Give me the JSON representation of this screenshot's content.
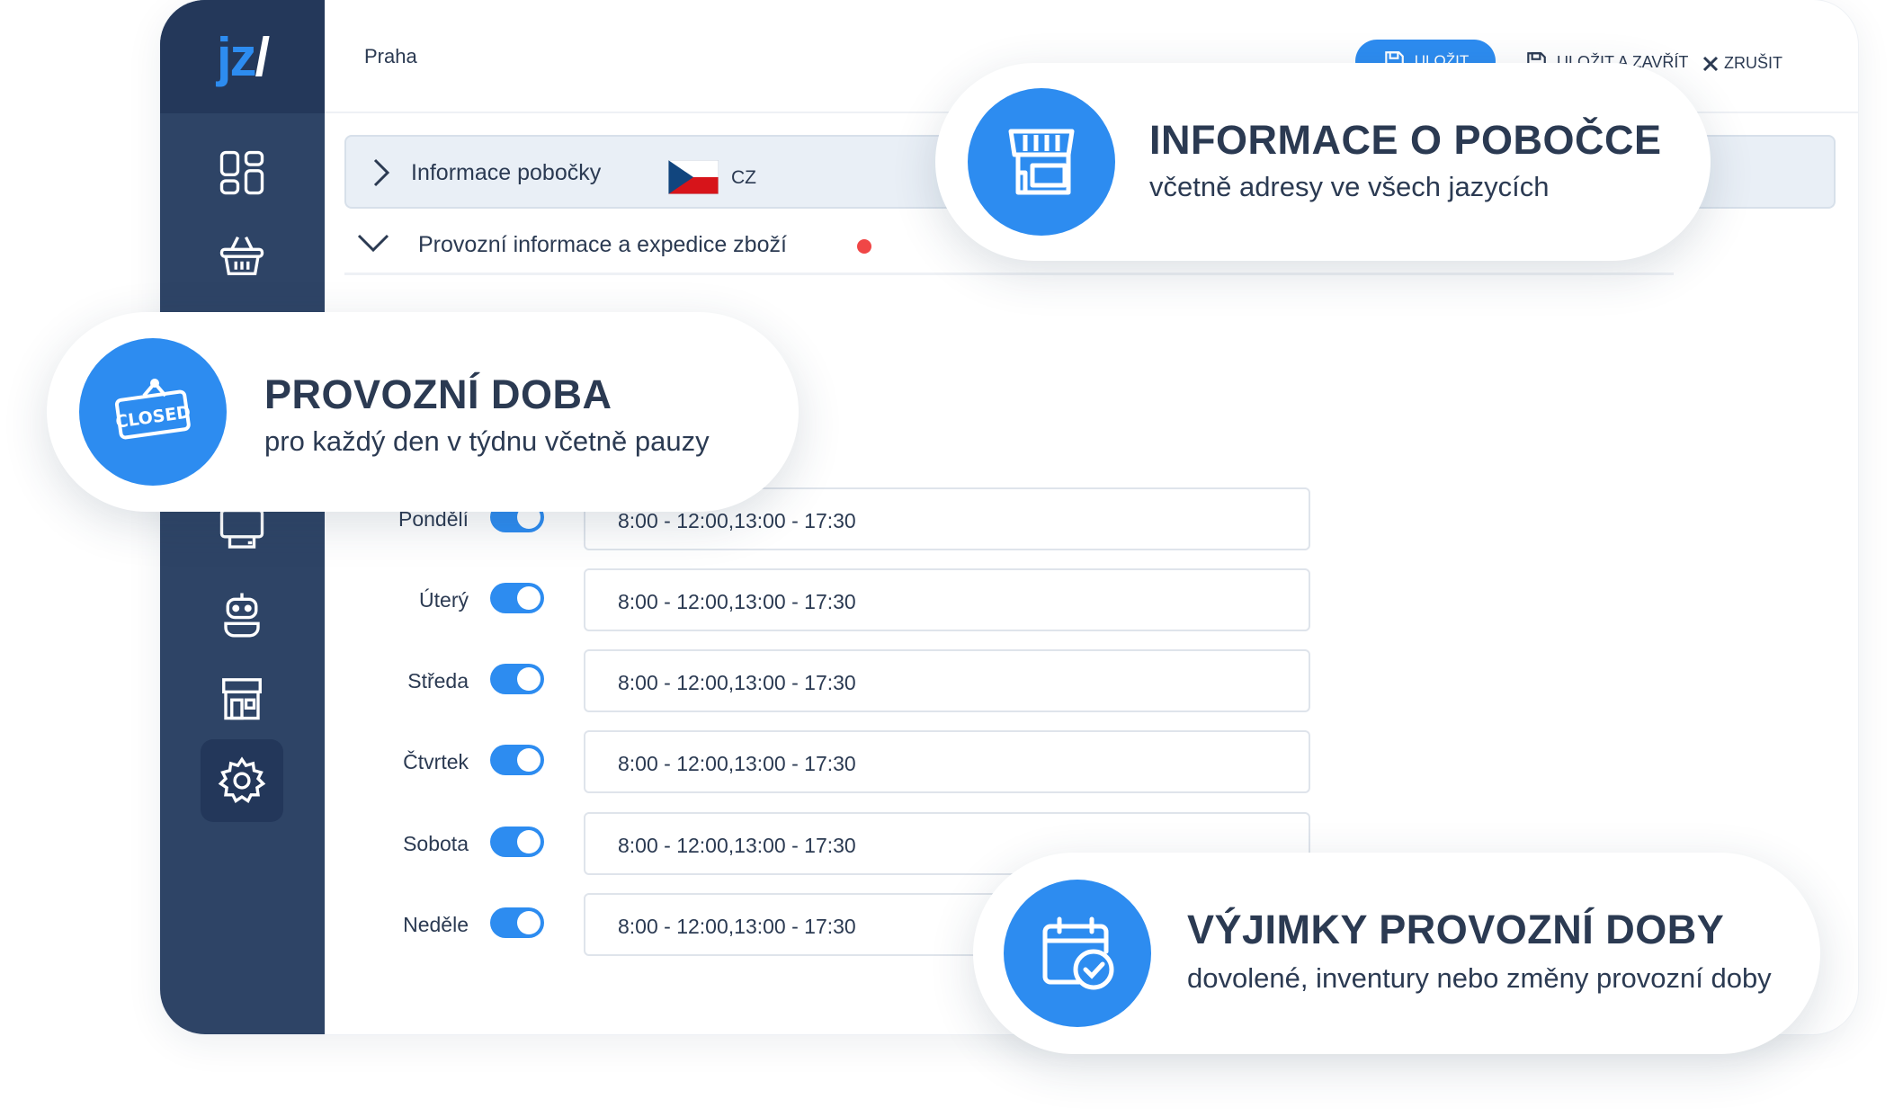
{
  "logo": {
    "text": "jz",
    "slash": "/"
  },
  "topbar": {
    "breadcrumb": "Praha",
    "save_label": "ULOŽIT",
    "save_close_label": "ULOŽIT A ZAVŘÍT",
    "cancel_label": "ZRUŠIT"
  },
  "sidebar": {
    "items": [
      {
        "icon": "dashboard-icon"
      },
      {
        "icon": "basket-icon"
      },
      {
        "icon": "register-icon"
      },
      {
        "icon": "robot-icon"
      },
      {
        "icon": "store-icon"
      },
      {
        "icon": "gear-icon",
        "active": true
      }
    ]
  },
  "branch_section": {
    "title": "Informace pobočky",
    "language": "CZ"
  },
  "operations_section": {
    "title": "Provozní informace a expedice zboží"
  },
  "opening_hours": [
    {
      "day": "Pondělí",
      "enabled": true,
      "hours": "8:00 - 12:00,13:00 - 17:30"
    },
    {
      "day": "Úterý",
      "enabled": true,
      "hours": "8:00 - 12:00,13:00 - 17:30"
    },
    {
      "day": "Středa",
      "enabled": true,
      "hours": "8:00 - 12:00,13:00 - 17:30"
    },
    {
      "day": "Čtvrtek",
      "enabled": true,
      "hours": "8:00 - 12:00,13:00 - 17:30"
    },
    {
      "day": "Sobota",
      "enabled": true,
      "hours": "8:00 - 12:00,13:00 - 17:30"
    },
    {
      "day": "Neděle",
      "enabled": true,
      "hours": "8:00 - 12:00,13:00 - 17:30"
    }
  ],
  "callouts": {
    "branch_info": {
      "heading": "INFORMACE O POBOČCE",
      "sub": "včetně adresy ve všech jazycích",
      "icon": "storefront-icon"
    },
    "opening_hours": {
      "heading": "PROVOZNÍ DOBA",
      "sub": "pro každý den v týdnu včetně pauzy",
      "icon": "closed-sign-icon",
      "sign_text": "CLOSED"
    },
    "exceptions": {
      "heading": "VÝJIMKY PROVOZNÍ DOBY",
      "sub": "dovolené, inventury nebo změny provozní doby",
      "icon": "calendar-check-icon"
    }
  },
  "colors": {
    "accent": "#2d8cf0",
    "sidebar": "#2e4466",
    "text": "#2b3a52",
    "alert": "#f04646"
  }
}
